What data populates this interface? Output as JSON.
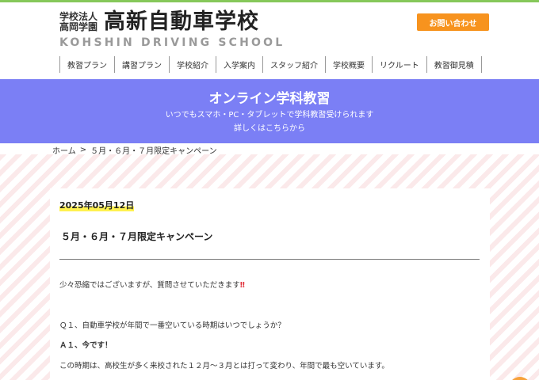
{
  "header": {
    "corp_line1": "学校法人",
    "corp_line2": "高岡学園",
    "school_name": "高新自動車学校",
    "school_name_en": "KOHSHIN DRIVING SCHOOL",
    "contact_label": "お問い合わせ"
  },
  "nav": {
    "items": [
      {
        "label": "教習プラン"
      },
      {
        "label": "講習プラン"
      },
      {
        "label": "学校紹介"
      },
      {
        "label": "入学案内"
      },
      {
        "label": "スタッフ紹介"
      },
      {
        "label": "学校概要"
      },
      {
        "label": "リクルート"
      },
      {
        "label": "教習御見積"
      }
    ]
  },
  "banner": {
    "title": "オンライン学科教習",
    "line1": "いつでもスマホ・PC・タブレットで学科教習受けられます",
    "line2": "詳しくはこちらから"
  },
  "breadcrumb": {
    "home": "ホーム",
    "separator": ">",
    "current": "５月・６月・７月限定キャンペーン"
  },
  "article": {
    "date": "2025年05月12日",
    "title": "５月・６月・７月限定キャンペーン",
    "p1": "少々恐縮ではございますが、質問させていただきます",
    "p1_mark": "‼",
    "q1": "Ｑ１、自動車学校が年間で一番空いている時期はいつでしょうか？",
    "a1": "Ａ１、今です！",
    "p4": "この時期は、高校生が多く来校された１２月～３月とは打って変わり、年間で最も空いています。"
  },
  "colors": {
    "accent_green": "#86c85a",
    "contact_orange": "#f7931e",
    "banner_purple": "#7b7ff5",
    "date_highlight": "#fff14f"
  }
}
